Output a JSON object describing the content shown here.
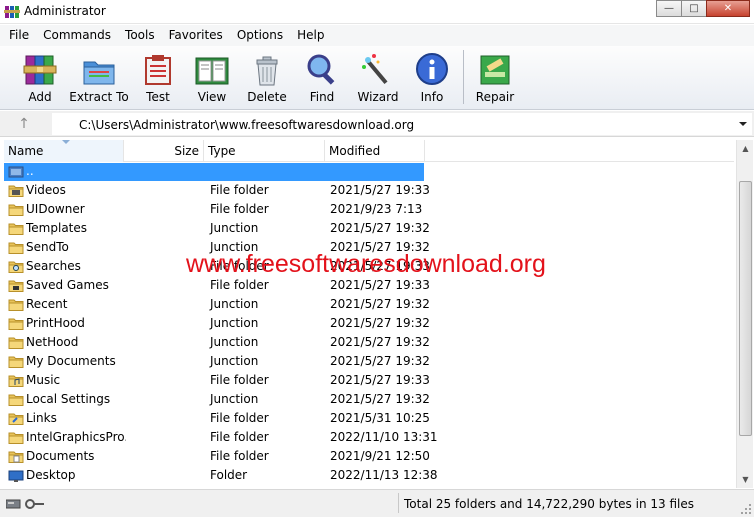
{
  "window": {
    "title": "Administrator",
    "buttons": {
      "minimize": "—",
      "maximize": "□",
      "close": "✕"
    }
  },
  "menu": [
    "File",
    "Commands",
    "Tools",
    "Favorites",
    "Options",
    "Help"
  ],
  "toolbar": {
    "buttons": [
      {
        "label": "Add",
        "icon": "winrar-books-icon"
      },
      {
        "label": "Extract To",
        "icon": "folder-extract-icon"
      },
      {
        "label": "Test",
        "icon": "first-aid-kit-icon"
      },
      {
        "label": "View",
        "icon": "open-book-icon"
      },
      {
        "label": "Delete",
        "icon": "trash-can-icon"
      },
      {
        "label": "Find",
        "icon": "magnifier-icon"
      },
      {
        "label": "Wizard",
        "icon": "magic-wand-icon"
      },
      {
        "label": "Info",
        "icon": "info-icon"
      },
      {
        "label": "Repair",
        "icon": "repair-kit-icon"
      }
    ]
  },
  "address": {
    "path": "C:\\Users\\Administrator\\www.freesoftwaresdownload.org",
    "up_glyph": "↑"
  },
  "columns": {
    "name": "Name",
    "size": "Size",
    "type": "Type",
    "modified": "Modified"
  },
  "files": [
    {
      "name": "..",
      "size": "",
      "type": "",
      "modified": "",
      "icon": "parent-dir-icon",
      "selected": true
    },
    {
      "name": "Videos",
      "size": "",
      "type": "File folder",
      "modified": "2021/5/27 19:33",
      "icon": "videos-folder-icon"
    },
    {
      "name": "UIDowner",
      "size": "",
      "type": "File folder",
      "modified": "2021/9/23 7:13",
      "icon": "folder-icon"
    },
    {
      "name": "Templates",
      "size": "",
      "type": "Junction",
      "modified": "2021/5/27 19:32",
      "icon": "folder-icon"
    },
    {
      "name": "SendTo",
      "size": "",
      "type": "Junction",
      "modified": "2021/5/27 19:32",
      "icon": "folder-icon"
    },
    {
      "name": "Searches",
      "size": "",
      "type": "File folder",
      "modified": "2021/5/27 19:33",
      "icon": "searches-folder-icon"
    },
    {
      "name": "Saved Games",
      "size": "",
      "type": "File folder",
      "modified": "2021/5/27 19:33",
      "icon": "saved-games-icon"
    },
    {
      "name": "Recent",
      "size": "",
      "type": "Junction",
      "modified": "2021/5/27 19:32",
      "icon": "folder-icon"
    },
    {
      "name": "PrintHood",
      "size": "",
      "type": "Junction",
      "modified": "2021/5/27 19:32",
      "icon": "folder-icon"
    },
    {
      "name": "NetHood",
      "size": "",
      "type": "Junction",
      "modified": "2021/5/27 19:32",
      "icon": "folder-icon"
    },
    {
      "name": "My Documents",
      "size": "",
      "type": "Junction",
      "modified": "2021/5/27 19:32",
      "icon": "folder-icon"
    },
    {
      "name": "Music",
      "size": "",
      "type": "File folder",
      "modified": "2021/5/27 19:33",
      "icon": "music-folder-icon"
    },
    {
      "name": "Local Settings",
      "size": "",
      "type": "Junction",
      "modified": "2021/5/27 19:32",
      "icon": "folder-icon"
    },
    {
      "name": "Links",
      "size": "",
      "type": "File folder",
      "modified": "2021/5/31 10:25",
      "icon": "links-folder-icon"
    },
    {
      "name": "IntelGraphicsPro...",
      "size": "",
      "type": "File folder",
      "modified": "2022/11/10 13:31",
      "icon": "folder-icon"
    },
    {
      "name": "Documents",
      "size": "",
      "type": "File folder",
      "modified": "2021/9/21 12:50",
      "icon": "documents-folder-icon"
    },
    {
      "name": "Desktop",
      "size": "",
      "type": "Folder",
      "modified": "2022/11/13 12:38",
      "icon": "desktop-folder-icon"
    }
  ],
  "watermark": "www.freesoftwaresdownload.org",
  "status": {
    "text": "Total 25 folders and 14,722,290 bytes in 13 files"
  },
  "colors": {
    "selection": "#3399ff",
    "watermark": "#e3121b",
    "toolbar_bg": "#e9edf3"
  }
}
